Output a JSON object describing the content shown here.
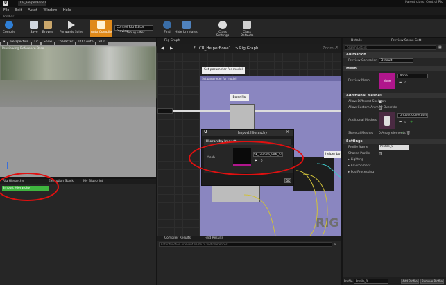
{
  "window": {
    "tab_title": "CR_HelperBone1",
    "parent_class": "Parent class:  Control Rig"
  },
  "menu": [
    "File",
    "Edit",
    "Asset",
    "Window",
    "Help"
  ],
  "toolbar": {
    "label": "Toolbar",
    "buttons": [
      "Compile",
      "Save",
      "Browse",
      "Forwards Solve",
      "Auto Compile",
      "Find",
      "Hide Unrelated",
      "Class Settings",
      "Class Defaults"
    ],
    "preview_dropdown": "Control Rig Editor Preview",
    "debug_filter": "Debug Filter"
  },
  "viewport": {
    "buttons": [
      "Perspective",
      "Lit",
      "Show",
      "Character",
      "LOD Auto",
      "x1.0"
    ],
    "overlay_text": "Previewing Reference Pose"
  },
  "left_tabs": [
    "Rig Hierarchy",
    "Execution Stack",
    "My Blueprint"
  ],
  "hierarchy_item": "Import Hierarchy",
  "graph": {
    "tab": "Rig Graph",
    "breadcrumb_root": "CR_HelperBone1",
    "breadcrumb_leaf": "Rig Graph",
    "zoom": "Zoom -5",
    "comment_title": "Set parameter  for model",
    "comment_header": "Set parameter for model",
    "bone_no": "Bone No",
    "helper_label": "helper bo",
    "watermark": "RIG"
  },
  "dialog": {
    "title": "Import Hierarchy",
    "section": "Hierarchy Import",
    "mesh_label": "Mesh",
    "mesh_value": "SK_Gamma_VRM_Scene",
    "ok": "OK"
  },
  "bottom": {
    "tabs": [
      "Compiler Results",
      "Find Results"
    ],
    "search_placeholder": "Enter function or event name to find references..."
  },
  "details": {
    "tabs": [
      "Details",
      "Preview Scene Sett"
    ],
    "search_placeholder": "Search Details",
    "animation_header": "Animation",
    "preview_controller_label": "Preview Controller",
    "preview_controller_value": "Default",
    "mesh_header": "Mesh",
    "preview_mesh_label": "Preview Mesh",
    "preview_mesh_thumb": "None",
    "preview_mesh_value": "None",
    "additional_header": "Additional Meshes",
    "allow_skeleton": "Allow Different Skeleton",
    "allow_custom_anim": "Allow Custom AnimBP Override",
    "additional_meshes_label": "Additional Meshes",
    "additional_meshes_value": "UnusedCollection",
    "skeletal_meshes_label": "Skeletal Meshes",
    "skeletal_meshes_value": "0 Array elements",
    "settings_header": "Settings",
    "profile_name_label": "Profile Name",
    "profile_name_value": "Profile_0",
    "shared_profile_label": "Shared Profile",
    "sub_sections": [
      "Lighting",
      "Environment",
      "PostProcessing"
    ],
    "footer_profile_label": "Profile",
    "footer_profile_value": "Profile_0",
    "add_profile": "Add Profile",
    "remove_profile": "Remove Profile"
  },
  "colors": {
    "accent_orange": "#e08a1a",
    "annotation_red": "#e01010",
    "hierarchy_green": "#3fb53f",
    "comment_purple": "#8a86c0",
    "mesh_pink": "#b0168c"
  }
}
